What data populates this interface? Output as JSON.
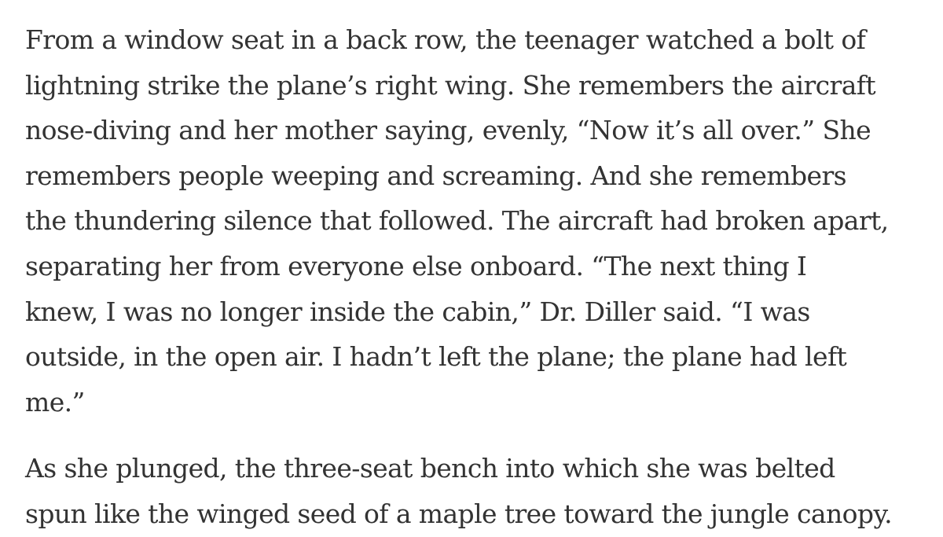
{
  "article": {
    "paragraphs": [
      {
        "lines": [
          "From a window seat in a back row, the teenager watched a bolt of",
          "lightning strike the plane’s right wing. She remembers the aircraft",
          "nose-diving and her mother saying, evenly, “Now it’s all over.” She",
          "remembers people weeping and screaming. And she remembers",
          "the thundering silence that followed. The aircraft had broken apart,",
          "separating her from everyone else onboard. “The next thing I",
          "knew, I was no longer inside the cabin,” Dr. Diller said. “I was",
          "outside, in the open air. I hadn’t left the plane; the plane had left",
          "me.”"
        ]
      },
      {
        "lines": [
          "As she plunged, the three-seat bench into which she was belted",
          "spun like the winged seed of a maple tree toward the jungle canopy."
        ]
      }
    ]
  }
}
